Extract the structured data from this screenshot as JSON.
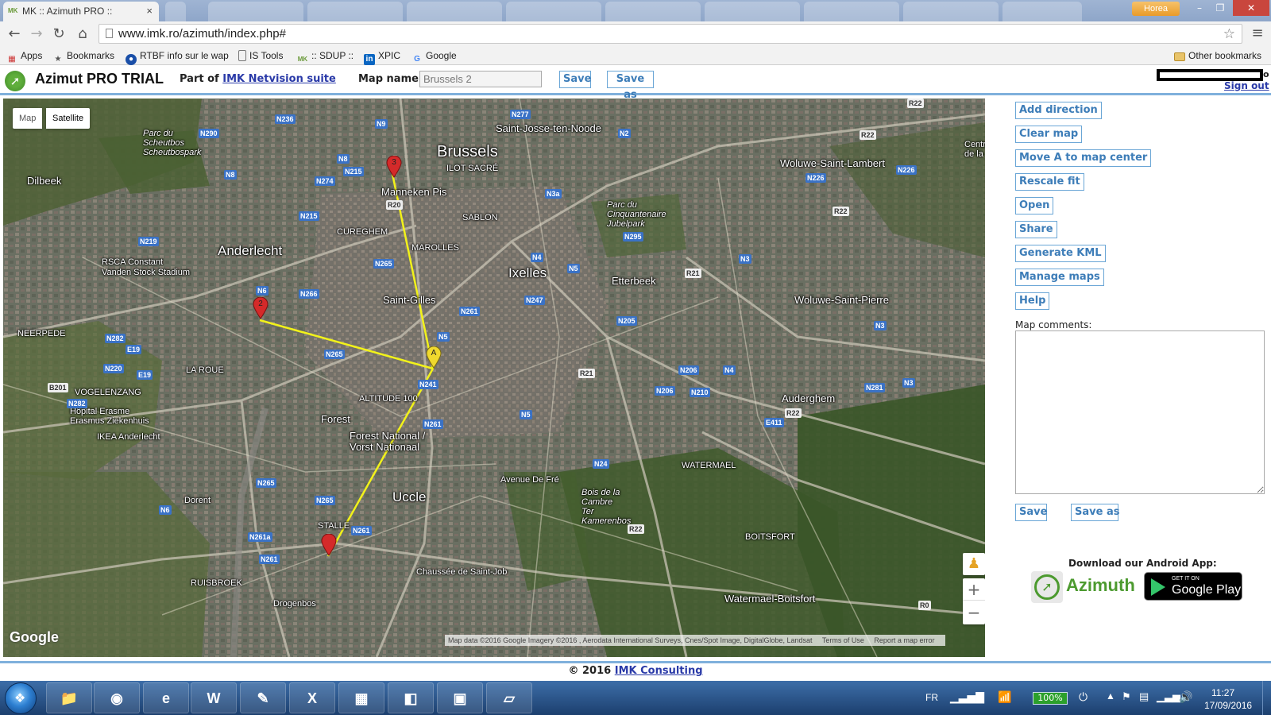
{
  "browser": {
    "active_tab": {
      "title": "MK :: Azimuth PRO ::",
      "favicon": "MK"
    },
    "background_tabs": [
      "",
      "",
      "",
      "",
      "",
      "",
      "",
      "",
      "",
      ""
    ],
    "user_badge": "Horea",
    "url": "www.imk.ro/azimuth/index.php#",
    "bookmarks": [
      {
        "label": "Apps",
        "icon": "apps-grid-icon"
      },
      {
        "label": "Bookmarks",
        "icon": "star-icon"
      },
      {
        "label": "RTBF info sur le wap",
        "icon": "rtbf-icon"
      },
      {
        "label": "IS Tools",
        "icon": "page-icon"
      },
      {
        "label": ":: SDUP ::",
        "icon": "mk-icon"
      },
      {
        "label": "XPIC",
        "icon": "linkedin-icon"
      },
      {
        "label": "Google",
        "icon": "google-g-icon"
      }
    ],
    "other_bookmarks": "Other bookmarks"
  },
  "app": {
    "title": "Azimut PRO TRIAL",
    "partof_prefix": "Part of",
    "partof_link": "IMK Netvision suite",
    "mapname_label": "Map name:",
    "mapname_value": "Brussels 2",
    "save_label": "Save",
    "saveas_label": "Save as",
    "user_suffix": "o",
    "signout_label": "Sign out"
  },
  "map": {
    "type_map": "Map",
    "type_satellite": "Satellite",
    "selected_type": "Satellite",
    "markers": [
      {
        "label": "3",
        "color": "#d42a2a"
      },
      {
        "label": "2",
        "color": "#d42a2a"
      },
      {
        "label": "A",
        "color": "#f0d92e"
      },
      {
        "label": "",
        "color": "#d42a2a"
      }
    ],
    "direction_line_color": "#f2f21a",
    "labels": {
      "brussels": "Brussels",
      "anderlecht": "Anderlecht",
      "ixelles": "Ixelles",
      "uccle": "Uccle",
      "saint_josse": "Saint-Josse-ten-Noode",
      "ilot_sacre": "ILOT SACRÉ",
      "manneken": "Manneken Pis",
      "sablon": "SABLON",
      "marolles": "MAROLLES",
      "cureghem": "CUREGHEM",
      "saint_gilles": "Saint-Gilles",
      "etterbeek": "Etterbeek",
      "woluwe_lambert": "Woluwe-Saint-Lambert",
      "woluwe_pierre": "Woluwe-Saint-Pierre",
      "auderghem": "Auderghem",
      "watermael": "WATERMAEL",
      "boitsfort": "BOITSFORT",
      "watermael_boitsfort": "Watermael-Boitsfort",
      "forest": "Forest",
      "forest_national": "Forest National /\nVorst Nationaal",
      "altitude": "ALTITUDE 100",
      "dilbeek": "Dilbeek",
      "neerpede": "NEERPEDE",
      "la_roue": "LA ROUE",
      "vogelenzang": "VOGELENZANG",
      "hopital": "Hôpital Erasme\nErasmus Ziekenhuis",
      "ikea": "IKEA Anderlecht",
      "rsca": "RSCA Constant\nVanden Stock Stadium",
      "parc_scheutbos": "Parc du\nScheutbos\nScheutbospark",
      "parc_cinq": "Parc du\nCinquantenaire\nJubelpark",
      "bois_cambre": "Bois de la\nCambre\nTer\nKamerenbos",
      "stalle": "STALLE",
      "dorent": "Dorent",
      "ruisbroek": "RUISBROEK",
      "drogenbos": "Drogenbos",
      "centre": "Centr\nde la",
      "avenue_fre": "Avenue De Fré",
      "chaussee_job": "Chaussée de Saint-Job"
    },
    "roads": [
      "N236",
      "N277",
      "N9",
      "N2",
      "R22",
      "N8",
      "N215",
      "N274",
      "N290",
      "N8",
      "N215",
      "N219",
      "R20",
      "N3a",
      "N226",
      "N226",
      "R22",
      "N295",
      "N265",
      "N6",
      "N266",
      "N4",
      "N5",
      "N3",
      "R21",
      "N282",
      "N220",
      "N265",
      "N261",
      "N247",
      "N205",
      "N5",
      "N3",
      "R21",
      "N206",
      "N206",
      "N210",
      "N4",
      "N281",
      "N3",
      "N241",
      "N5",
      "E19",
      "E19",
      "B201",
      "N282",
      "N265",
      "N261",
      "N24",
      "E411",
      "R22",
      "R22",
      "N265",
      "N6",
      "N261a",
      "N261",
      "N261",
      "R22",
      "R0"
    ],
    "google_logo": "Google",
    "attribution": "Map data ©2016 Google Imagery ©2016 , Aerodata International Surveys, Cnes/Spot Image, DigitalGlobe, Landsat",
    "terms": "Terms of Use",
    "report": "Report a map error",
    "zoom_in": "+",
    "zoom_out": "−"
  },
  "sidebar": {
    "buttons": [
      "Add direction",
      "Clear map",
      "Move A to map center",
      "Rescale fit",
      "Open",
      "Share",
      "Generate KML",
      "Manage maps",
      "Help"
    ],
    "comments_label": "Map comments:",
    "comments_value": "",
    "save_label": "Save",
    "saveas_label": "Save as",
    "download_label": "Download our Android App:",
    "azimuth_badge_text": "Azimuth",
    "gplay_small": "GET IT ON",
    "gplay_big": "Google Play"
  },
  "footer": {
    "copyright": "© 2016",
    "link": "IMK Consulting"
  },
  "taskbar": {
    "apps": [
      "explorer-folder-icon",
      "chrome-icon",
      "ie-icon",
      "word-icon",
      "paint-icon",
      "excel-icon",
      "calculator-icon",
      "office-icon",
      "photo-viewer-icon",
      "notes-icon"
    ],
    "language": "FR",
    "battery": "100%",
    "time": "11:27",
    "date": "17/09/2016"
  }
}
